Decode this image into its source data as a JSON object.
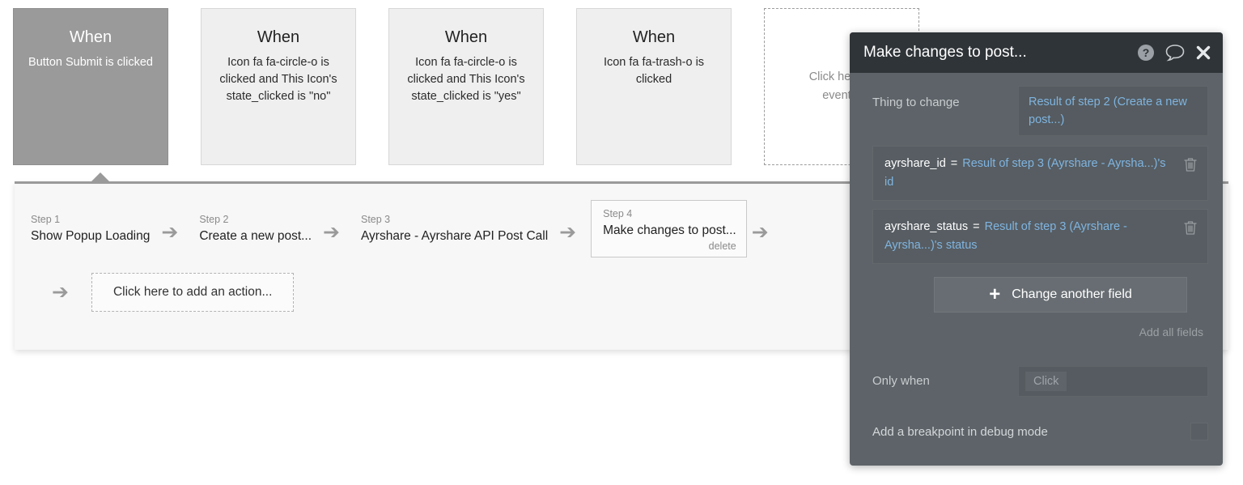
{
  "events": {
    "cards": [
      {
        "when_label": "When",
        "description": "Button Submit is clicked",
        "selected": true,
        "type": "event"
      },
      {
        "when_label": "When",
        "description": "Icon fa fa-circle-o is clicked and This Icon's state_clicked is \"no\"",
        "selected": false,
        "type": "event"
      },
      {
        "when_label": "When",
        "description": "Icon fa fa-circle-o is clicked and This Icon's state_clicked is \"yes\"",
        "selected": false,
        "type": "event"
      },
      {
        "when_label": "When",
        "description": "Icon fa fa-trash-o is clicked",
        "selected": false,
        "type": "event"
      }
    ],
    "placeholder": {
      "line1": "Click here to",
      "line2": "event..."
    }
  },
  "workflow": {
    "steps": [
      {
        "number": "Step 1",
        "name": "Show Popup Loading"
      },
      {
        "number": "Step 2",
        "name": "Create a new post..."
      },
      {
        "number": "Step 3",
        "name": "Ayrshare - Ayrshare API Post Call"
      },
      {
        "number": "Step 4",
        "name": "Make changes to post...",
        "delete_label": "delete",
        "selected": true
      }
    ],
    "arrow_glyph": "➔",
    "add_action_label": "Click here to add an action..."
  },
  "properties": {
    "title": "Make changes to post...",
    "icons": {
      "help": "help-circle-icon",
      "comment": "comment-bubble-icon",
      "close": "close-icon"
    },
    "thing_to_change": {
      "label": "Thing to change",
      "value": "Result of step 2 (Create a new post...)"
    },
    "fields": [
      {
        "key": "ayrshare_id",
        "operator": "=",
        "value": "Result of step 3 (Ayrshare - Ayrsha...)'s id"
      },
      {
        "key": "ayrshare_status",
        "operator": "=",
        "value": "Result of step 3 (Ayrshare - Ayrsha...)'s status"
      }
    ],
    "change_another_field_label": "Change another field",
    "change_another_field_plus": "+",
    "add_all_fields_label": "Add all fields",
    "only_when": {
      "label": "Only when",
      "placeholder_chip": "Click"
    },
    "breakpoint": {
      "label": "Add a breakpoint in debug mode",
      "checked": false
    }
  },
  "colors": {
    "panel_bg": "#5d6368",
    "panel_header_bg": "#2f3438",
    "link_blue": "#7fb4e0",
    "selected_card_gray": "#9a9a9a",
    "card_gray": "#efefef"
  }
}
